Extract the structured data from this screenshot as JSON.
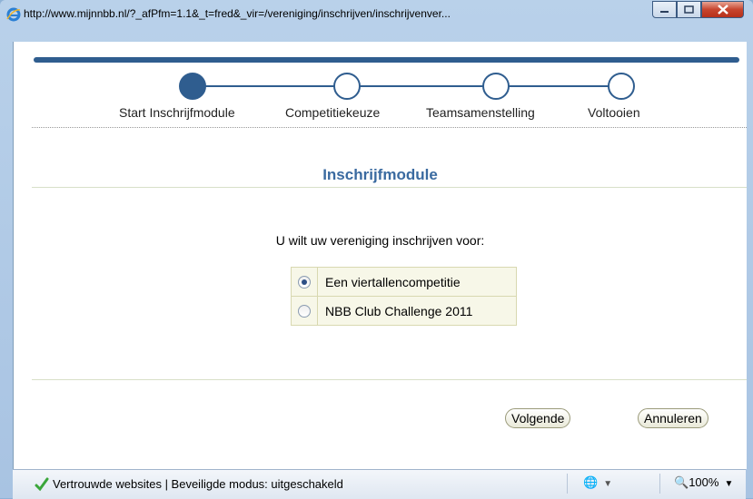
{
  "window": {
    "url": "http://www.mijnnbb.nl/?_afPfm=1.1&_t=fred&_vir=/vereniging/inschrijven/inschrijvenver..."
  },
  "steps": [
    {
      "label": "Start Inschrijfmodule",
      "active": true
    },
    {
      "label": "Competitiekeuze",
      "active": false
    },
    {
      "label": "Teamsamenstelling",
      "active": false
    },
    {
      "label": "Voltooien",
      "active": false
    }
  ],
  "main": {
    "heading": "Inschrijfmodule",
    "question": "U wilt uw vereniging inschrijven voor:",
    "options": [
      {
        "label": "Een viertallencompetitie",
        "selected": true
      },
      {
        "label": "NBB Club Challenge 2011",
        "selected": false
      }
    ]
  },
  "buttons": {
    "next": "Volgende",
    "cancel": "Annuleren"
  },
  "statusbar": {
    "zone": "Vertrouwde websites | Beveiligde modus: uitgeschakeld",
    "zoom": "100%"
  },
  "colors": {
    "accent": "#2f5d8f",
    "heading": "#3a6aa0"
  }
}
